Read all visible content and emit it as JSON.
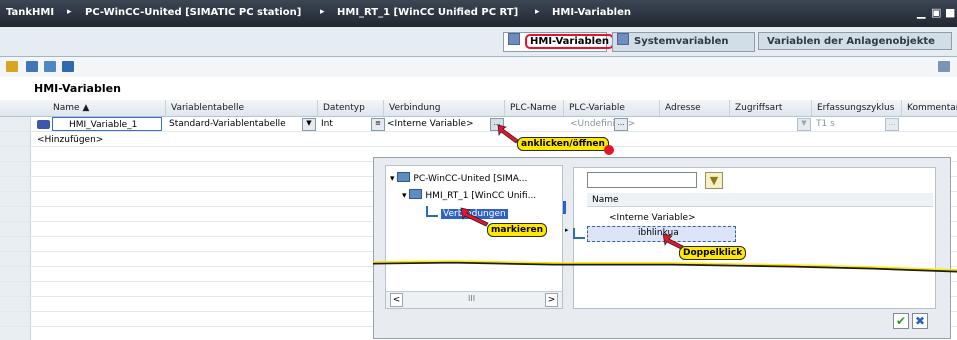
{
  "titlebar": {
    "crumbs": [
      "TankHMI",
      "PC-WinCC-United [SIMATIC PC station]",
      "HMI_RT_1 [WinCC Unified PC RT]",
      "HMI-Variablen"
    ],
    "separator": "▸"
  },
  "tabs": {
    "hmi": "HMI-Variablen",
    "system": "Systemvariablen",
    "objects": "Variablen der Anlagenobjekte"
  },
  "page_title": "HMI-Variablen",
  "columns": [
    "Name",
    "Variablentabelle",
    "Datentyp",
    "Verbindung",
    "PLC-Name",
    "PLC-Variable",
    "Adresse",
    "Zugriffsart",
    "Erfassungszyklus",
    "Kommentar"
  ],
  "row1": {
    "name": "HMI_Variable_1",
    "table": "Standard-Variablentabelle",
    "datatype": "Int",
    "connection": "<Interne Variable>",
    "plc_var": "<Undefiniert>",
    "cycle": "T1 s",
    "dots": "..."
  },
  "add_row": "<Hinzufügen>",
  "callouts": {
    "open": "anklicken/öffnen",
    "mark": "markieren",
    "dbl": "Doppelklick"
  },
  "dialog": {
    "tree": [
      "PC-WinCC-United [SIMA...",
      "HMI_RT_1 [WinCC Unifi...",
      "Verbindungen"
    ],
    "list_header": "Name",
    "list_items": [
      "<Interne Variable>",
      "ibhlinkua"
    ],
    "scroll_mid": "III"
  },
  "colors": {
    "accent_red": "#e4142c",
    "callout_yellow": "#ffe800",
    "selection_blue": "#2f62c6"
  }
}
